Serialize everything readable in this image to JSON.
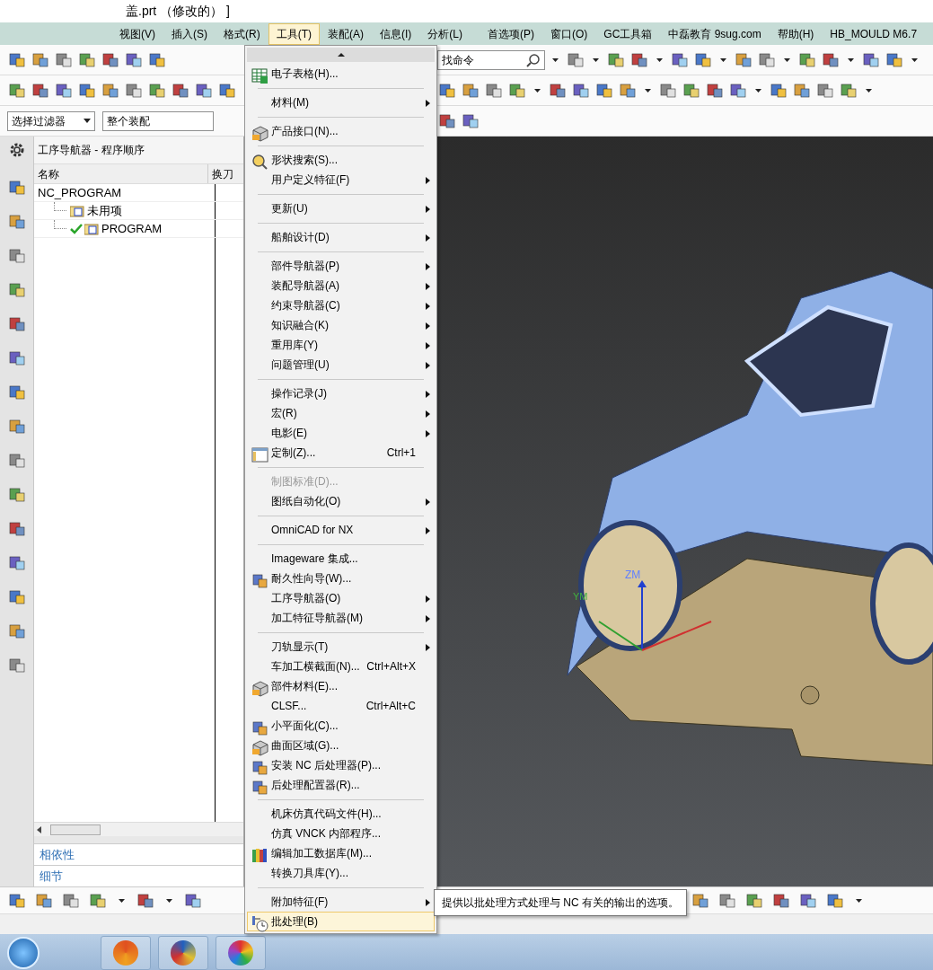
{
  "window": {
    "title": "盖.prt （修改的） ]"
  },
  "menu_bar": [
    {
      "label": "视图(V)",
      "selected": false
    },
    {
      "label": "插入(S)",
      "selected": false
    },
    {
      "label": "格式(R)",
      "selected": false
    },
    {
      "label": "工具(T)",
      "selected": true
    },
    {
      "label": "装配(A)",
      "selected": false
    },
    {
      "label": "信息(I)",
      "selected": false
    },
    {
      "label": "分析(L)",
      "selected": false
    },
    {
      "label": "首选项(P)",
      "selected": false
    },
    {
      "label": "窗口(O)",
      "selected": false
    },
    {
      "label": "GC工具箱",
      "selected": false
    },
    {
      "label": "中磊教育 9sug.com",
      "selected": false
    },
    {
      "label": "帮助(H)",
      "selected": false
    },
    {
      "label": "HB_MOULD M6.7",
      "selected": false
    }
  ],
  "command_search": {
    "value": "找命令"
  },
  "selection_filter": {
    "value": "选择过滤器"
  },
  "assembly_scope": {
    "value": "整个装配"
  },
  "navigator": {
    "title": "工序导航器 - 程序顺序",
    "columns": [
      "名称",
      "换刀"
    ],
    "tree": [
      {
        "label": "NC_PROGRAM",
        "checked": false,
        "children": [
          {
            "label": "未用项",
            "checked": false
          },
          {
            "label": "PROGRAM",
            "checked": true
          }
        ]
      }
    ],
    "panels": [
      "相依性",
      "细节"
    ]
  },
  "tools_menu": {
    "items": [
      {
        "kind": "item",
        "label": "电子表格(H)...",
        "submenu": false,
        "disabled": false,
        "selected": false
      },
      {
        "kind": "separator"
      },
      {
        "kind": "item",
        "label": "材料(M)",
        "submenu": true,
        "disabled": false,
        "selected": false
      },
      {
        "kind": "separator"
      },
      {
        "kind": "item",
        "label": "产品接口(N)...",
        "submenu": false,
        "disabled": false,
        "selected": false
      },
      {
        "kind": "separator"
      },
      {
        "kind": "item",
        "label": "形状搜索(S)...",
        "submenu": false,
        "disabled": false,
        "selected": false
      },
      {
        "kind": "item",
        "label": "用户定义特征(F)",
        "submenu": true,
        "disabled": false,
        "selected": false
      },
      {
        "kind": "separator"
      },
      {
        "kind": "item",
        "label": "更新(U)",
        "submenu": true,
        "disabled": false,
        "selected": false
      },
      {
        "kind": "separator"
      },
      {
        "kind": "item",
        "label": "船舶设计(D)",
        "submenu": true,
        "disabled": false,
        "selected": false
      },
      {
        "kind": "separator"
      },
      {
        "kind": "item",
        "label": "部件导航器(P)",
        "submenu": true,
        "disabled": false,
        "selected": false
      },
      {
        "kind": "item",
        "label": "装配导航器(A)",
        "submenu": true,
        "disabled": false,
        "selected": false
      },
      {
        "kind": "item",
        "label": "约束导航器(C)",
        "submenu": true,
        "disabled": false,
        "selected": false
      },
      {
        "kind": "item",
        "label": "知识融合(K)",
        "submenu": true,
        "disabled": false,
        "selected": false
      },
      {
        "kind": "item",
        "label": "重用库(Y)",
        "submenu": true,
        "disabled": false,
        "selected": false
      },
      {
        "kind": "item",
        "label": "问题管理(U)",
        "submenu": true,
        "disabled": false,
        "selected": false
      },
      {
        "kind": "separator"
      },
      {
        "kind": "item",
        "label": "操作记录(J)",
        "submenu": true,
        "disabled": false,
        "selected": false
      },
      {
        "kind": "item",
        "label": "宏(R)",
        "submenu": true,
        "disabled": false,
        "selected": false
      },
      {
        "kind": "item",
        "label": "电影(E)",
        "submenu": true,
        "disabled": false,
        "selected": false
      },
      {
        "kind": "item",
        "label": "定制(Z)...",
        "shortcut": "Ctrl+1",
        "submenu": false,
        "disabled": false,
        "selected": false
      },
      {
        "kind": "separator"
      },
      {
        "kind": "item",
        "label": "制图标准(D)...",
        "submenu": false,
        "disabled": true,
        "selected": false
      },
      {
        "kind": "item",
        "label": "图纸自动化(O)",
        "submenu": true,
        "disabled": false,
        "selected": false
      },
      {
        "kind": "separator"
      },
      {
        "kind": "item",
        "label": "OmniCAD for NX",
        "submenu": true,
        "disabled": false,
        "selected": false
      },
      {
        "kind": "separator"
      },
      {
        "kind": "item",
        "label": "Imageware 集成...",
        "submenu": false,
        "disabled": false,
        "selected": false
      },
      {
        "kind": "item",
        "label": "耐久性向导(W)...",
        "submenu": false,
        "disabled": false,
        "selected": false
      },
      {
        "kind": "item",
        "label": "工序导航器(O)",
        "submenu": true,
        "disabled": false,
        "selected": false
      },
      {
        "kind": "item",
        "label": "加工特征导航器(M)",
        "submenu": true,
        "disabled": false,
        "selected": false
      },
      {
        "kind": "separator"
      },
      {
        "kind": "item",
        "label": "刀轨显示(T)",
        "submenu": true,
        "disabled": false,
        "selected": false
      },
      {
        "kind": "item",
        "label": "车加工横截面(N)...",
        "shortcut": "Ctrl+Alt+X",
        "submenu": false,
        "disabled": false,
        "selected": false
      },
      {
        "kind": "item",
        "label": "部件材料(E)...",
        "submenu": false,
        "disabled": false,
        "selected": false
      },
      {
        "kind": "item",
        "label": "CLSF...",
        "shortcut": "Ctrl+Alt+C",
        "submenu": false,
        "disabled": false,
        "selected": false
      },
      {
        "kind": "item",
        "label": "小平面化(C)...",
        "submenu": false,
        "disabled": false,
        "selected": false
      },
      {
        "kind": "item",
        "label": "曲面区域(G)...",
        "submenu": false,
        "disabled": false,
        "selected": false
      },
      {
        "kind": "item",
        "label": "安装 NC 后处理器(P)...",
        "submenu": false,
        "disabled": false,
        "selected": false
      },
      {
        "kind": "item",
        "label": "后处理配置器(R)...",
        "submenu": false,
        "disabled": false,
        "selected": false
      },
      {
        "kind": "separator"
      },
      {
        "kind": "item",
        "label": "机床仿真代码文件(H)...",
        "submenu": false,
        "disabled": false,
        "selected": false
      },
      {
        "kind": "item",
        "label": "仿真 VNCK 内部程序...",
        "submenu": false,
        "disabled": false,
        "selected": false
      },
      {
        "kind": "item",
        "label": "编辑加工数据库(M)...",
        "submenu": false,
        "disabled": false,
        "selected": false
      },
      {
        "kind": "item",
        "label": "转换刀具库(Y)...",
        "submenu": false,
        "disabled": false,
        "selected": false
      },
      {
        "kind": "separator"
      },
      {
        "kind": "item",
        "label": "附加特征(F)",
        "submenu": true,
        "disabled": false,
        "selected": false
      },
      {
        "kind": "item",
        "label": "批处理(B)",
        "submenu": false,
        "disabled": false,
        "selected": true
      }
    ]
  },
  "tooltip": "提供以批处理方式处理与 NC 有关的输出的选项。",
  "viewport": {
    "axis_labels": [
      "ZM",
      "YM"
    ]
  }
}
